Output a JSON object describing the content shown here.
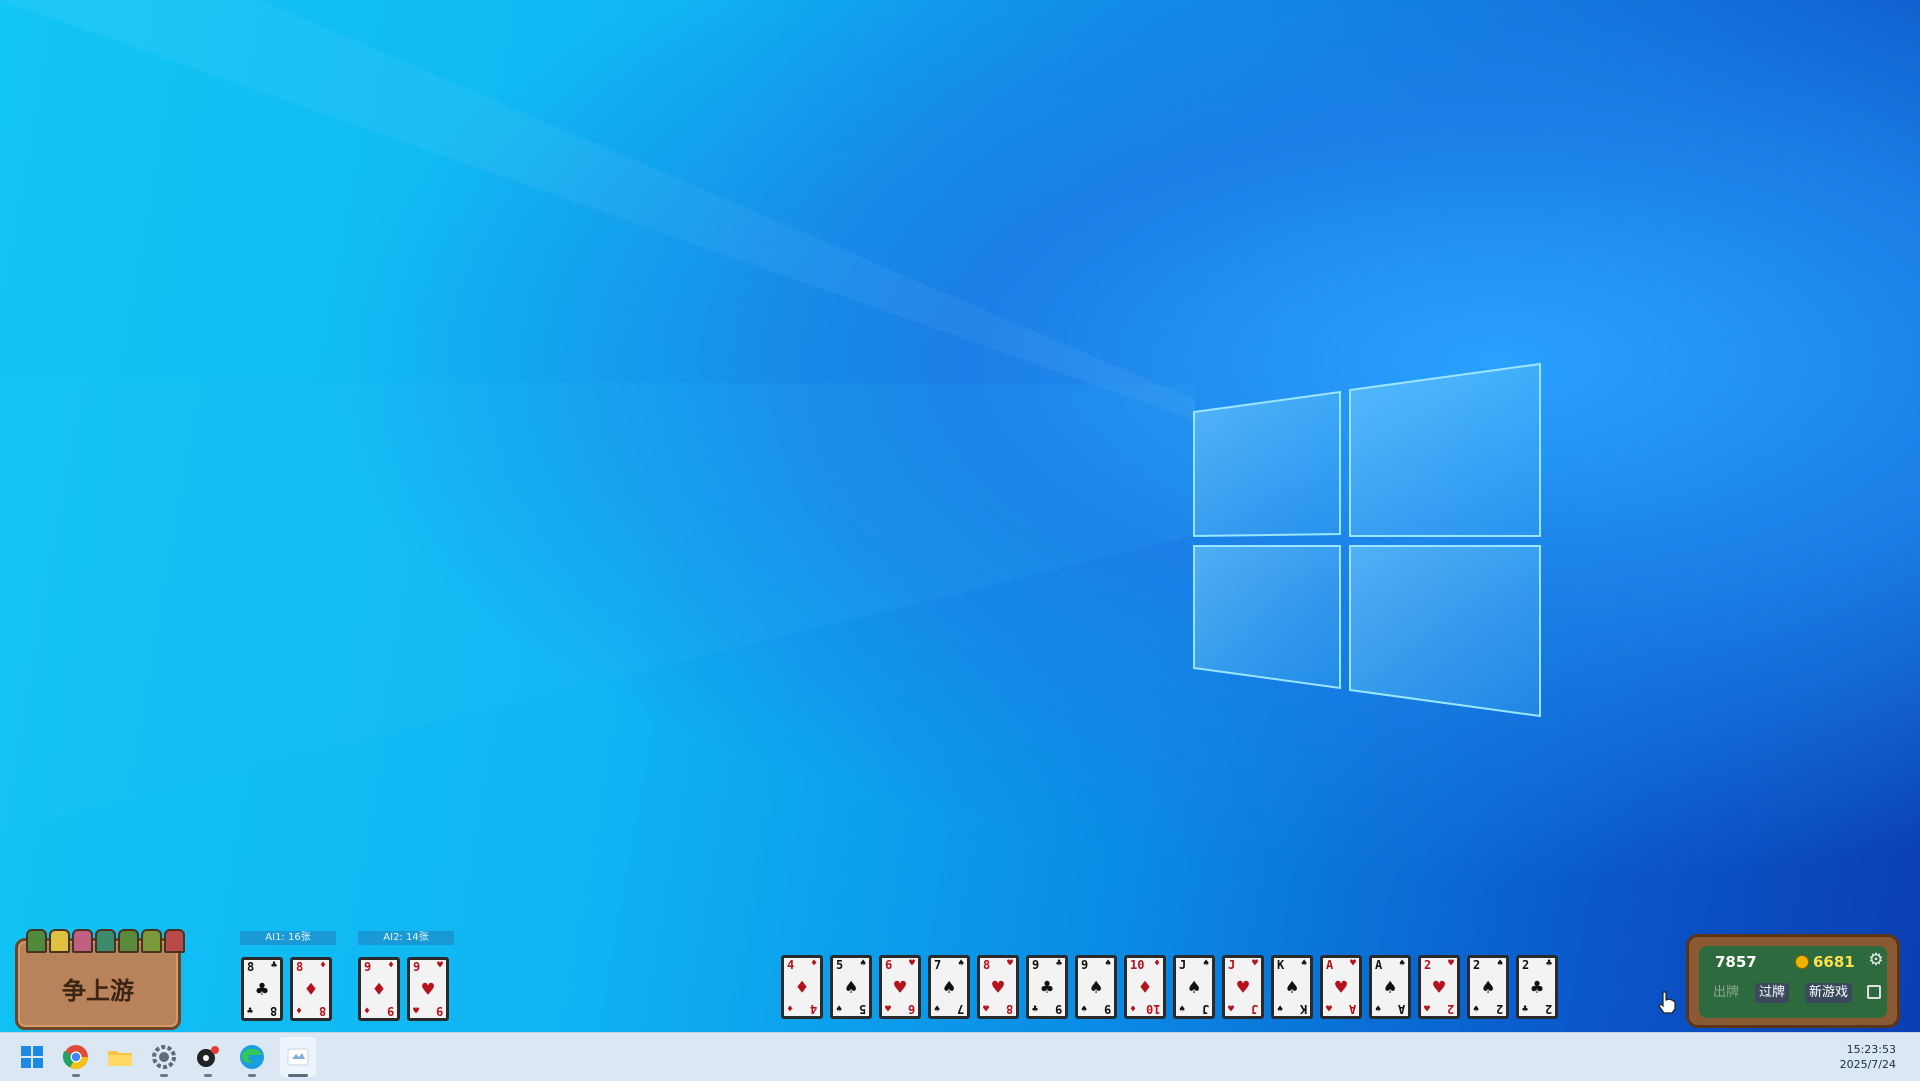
{
  "game": {
    "title": "争上游",
    "ai1_label": "AI1: 16张",
    "ai2_label": "AI2: 14张",
    "ai1_cards": [
      {
        "rank": "8",
        "suit": "♣",
        "color": "black"
      },
      {
        "rank": "8",
        "suit": "♦",
        "color": "red"
      }
    ],
    "ai2_cards": [
      {
        "rank": "9",
        "suit": "♦",
        "color": "red"
      },
      {
        "rank": "9",
        "suit": "♥",
        "color": "red"
      }
    ],
    "hand": [
      {
        "rank": "4",
        "suit": "♦",
        "color": "red"
      },
      {
        "rank": "5",
        "suit": "♠",
        "color": "black"
      },
      {
        "rank": "6",
        "suit": "♥",
        "color": "red"
      },
      {
        "rank": "7",
        "suit": "♠",
        "color": "black"
      },
      {
        "rank": "8",
        "suit": "♥",
        "color": "red"
      },
      {
        "rank": "9",
        "suit": "♣",
        "color": "black"
      },
      {
        "rank": "9",
        "suit": "♠",
        "color": "black"
      },
      {
        "rank": "10",
        "suit": "♦",
        "color": "red"
      },
      {
        "rank": "J",
        "suit": "♠",
        "color": "black"
      },
      {
        "rank": "J",
        "suit": "♥",
        "color": "red"
      },
      {
        "rank": "K",
        "suit": "♠",
        "color": "black"
      },
      {
        "rank": "A",
        "suit": "♥",
        "color": "red"
      },
      {
        "rank": "A",
        "suit": "♠",
        "color": "black"
      },
      {
        "rank": "2",
        "suit": "♥",
        "color": "red"
      },
      {
        "rank": "2",
        "suit": "♠",
        "color": "black"
      },
      {
        "rank": "2",
        "suit": "♣",
        "color": "black"
      }
    ],
    "panel": {
      "score": "7857",
      "coins": "6681",
      "play_label": "出牌",
      "pass_label": "过牌",
      "new_game_label": "新游戏"
    }
  },
  "taskbar": {
    "icons": [
      "windows-start-icon",
      "chrome-icon",
      "file-explorer-icon",
      "settings-icon",
      "media-app-icon",
      "edge-icon",
      "game-app-icon"
    ],
    "time": "15:23:53",
    "date": "2025/7/24"
  },
  "colors": {
    "wallpaper_left": "#12c6f5",
    "wallpaper_right": "#0a3fb2",
    "card_red": "#b5121b",
    "panel_felt": "#2d6a3d",
    "coin_text": "#ffe14a"
  }
}
